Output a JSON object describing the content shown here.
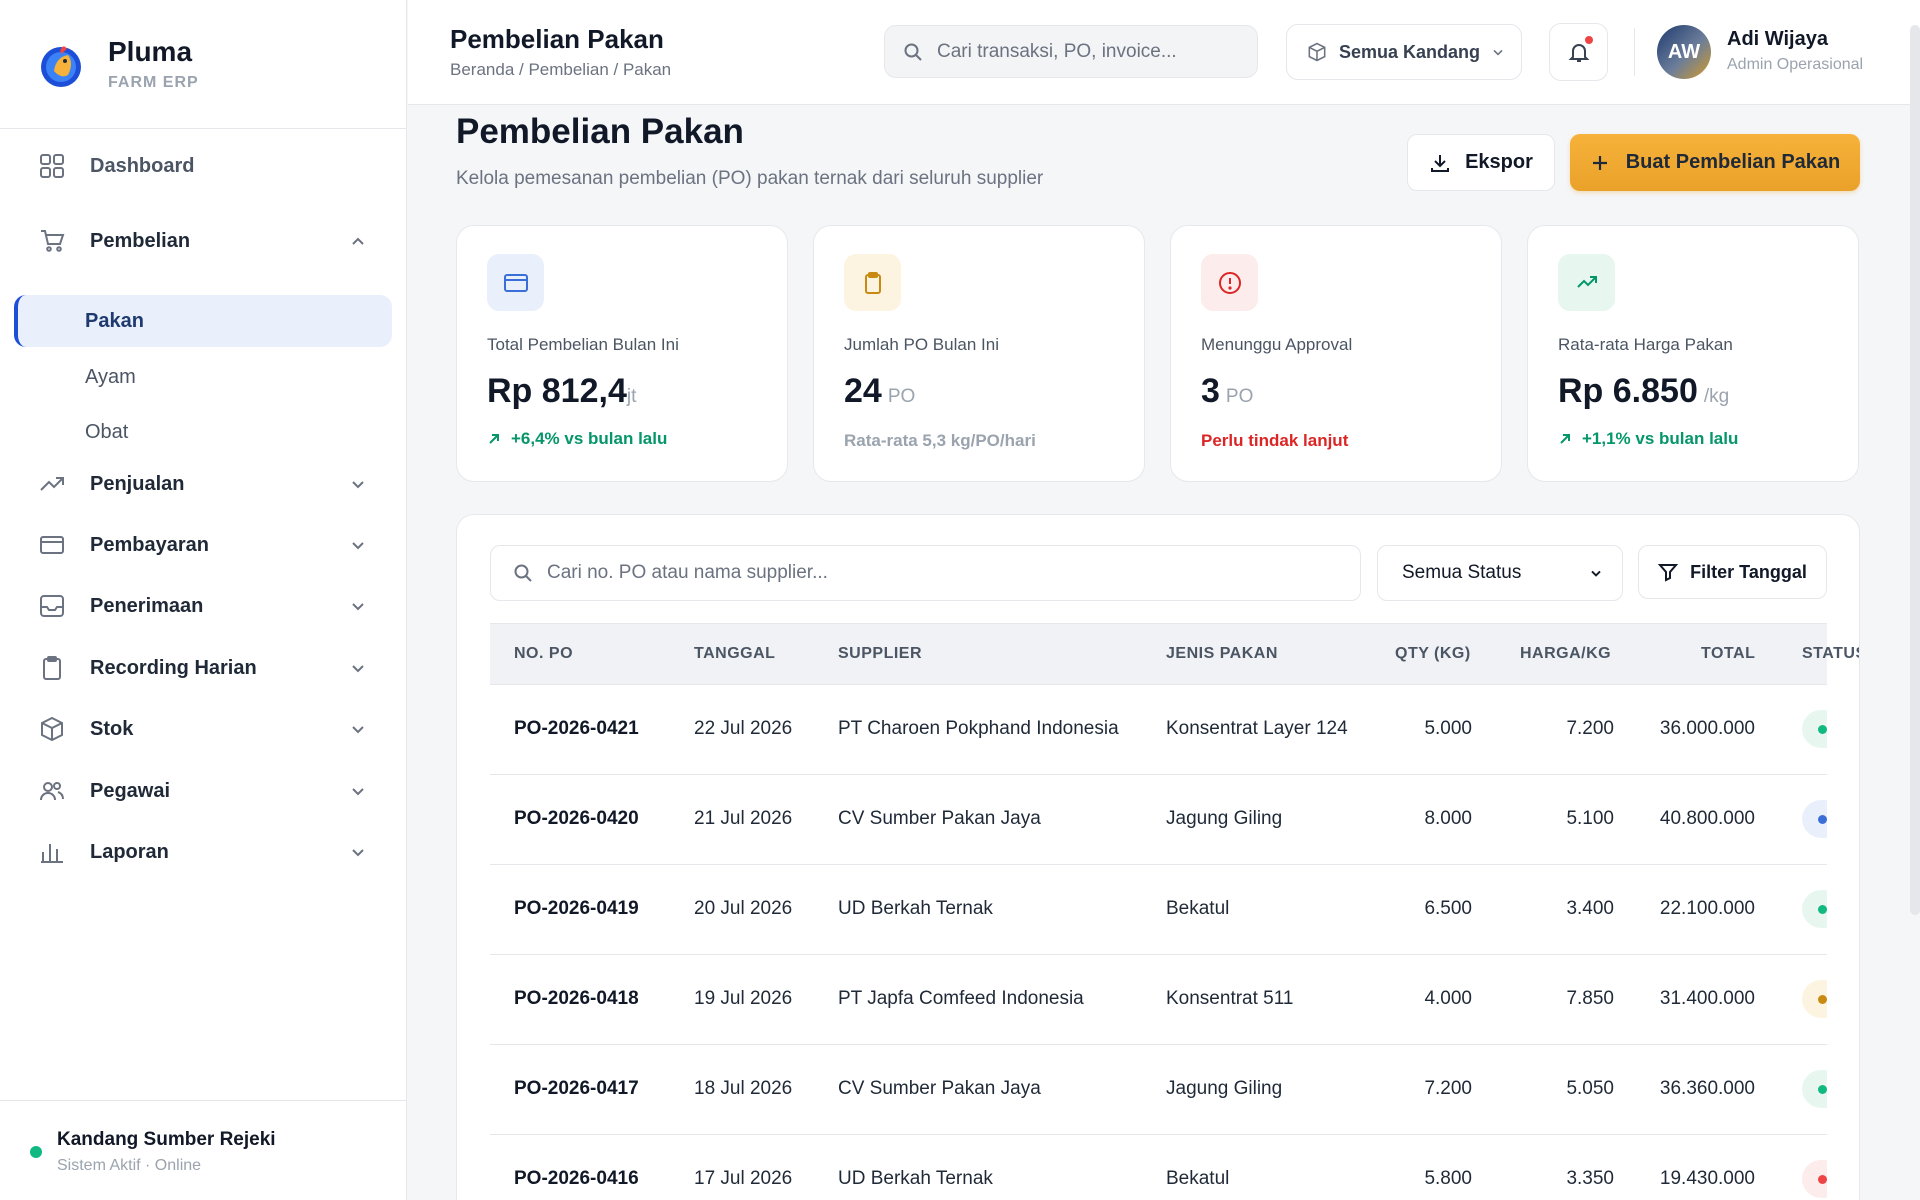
{
  "brand": {
    "name": "Pluma",
    "sub": "FARM ERP"
  },
  "sidebar": {
    "dashboard": "Dashboard",
    "pembelian": "Pembelian",
    "sub": [
      "Pakan",
      "Ayam",
      "Obat"
    ],
    "items": [
      "Penjualan",
      "Pembayaran",
      "Penerimaan",
      "Recording Harian",
      "Stok",
      "Pegawai",
      "Laporan"
    ],
    "footer": {
      "title": "Kandang Sumber Rejeki",
      "sub": "Sistem Aktif · Online"
    }
  },
  "topbar": {
    "title": "Pembelian Pakan",
    "breadcrumb": "Beranda / Pembelian / Pakan",
    "search_placeholder": "Cari transaksi, PO, invoice...",
    "kandang_select": "Semua Kandang",
    "user": {
      "initials": "AW",
      "name": "Adi Wijaya",
      "role": "Admin Operasional"
    }
  },
  "page": {
    "heading": "Pembelian Pakan",
    "subtitle": "Kelola pemesanan pembelian (PO) pakan ternak dari seluruh supplier",
    "export_label": "Ekspor",
    "create_label": "Buat Pembelian Pakan"
  },
  "stats": [
    {
      "label": "Total Pembelian Bulan Ini",
      "value": "Rp 812,4",
      "unit": "jt",
      "foot": "+6,4% vs bulan lalu",
      "icon": "credit-card-icon"
    },
    {
      "label": "Jumlah PO Bulan Ini",
      "value": "24",
      "unit": "PO",
      "foot": "Rata-rata 5,3 kg/PO/hari",
      "icon": "clipboard-icon"
    },
    {
      "label": "Menunggu Approval",
      "value": "3",
      "unit": "PO",
      "foot": "Perlu tindak lanjut",
      "icon": "alert-circle-icon"
    },
    {
      "label": "Rata-rata Harga Pakan",
      "value": "Rp 6.850",
      "unit": "/kg",
      "foot": "+1,1% vs bulan lalu",
      "icon": "trending-up-icon"
    }
  ],
  "table": {
    "search_placeholder": "Cari no. PO atau nama supplier...",
    "status_select": "Semua Status",
    "filter_label": "Filter Tanggal",
    "headers": [
      "NO. PO",
      "TANGGAL",
      "SUPPLIER",
      "JENIS PAKAN",
      "QTY (KG)",
      "HARGA/KG",
      "TOTAL",
      "STATUS"
    ],
    "rows": [
      {
        "po": "PO-2026-0421",
        "date": "22 Jul 2026",
        "supplier": "PT Charoen Pokphand Indonesia",
        "feed": "Konsentrat Layer 124",
        "qty": "5.000",
        "price": "7.200",
        "total": "36.000.000",
        "status_color": "#10b981",
        "status_bg": "#e7f7f0"
      },
      {
        "po": "PO-2026-0420",
        "date": "21 Jul 2026",
        "supplier": "CV Sumber Pakan Jaya",
        "feed": "Jagung Giling",
        "qty": "8.000",
        "price": "5.100",
        "total": "40.800.000",
        "status_color": "#3b6fd8",
        "status_bg": "#eaf0fb"
      },
      {
        "po": "PO-2026-0419",
        "date": "20 Jul 2026",
        "supplier": "UD Berkah Ternak",
        "feed": "Bekatul",
        "qty": "6.500",
        "price": "3.400",
        "total": "22.100.000",
        "status_color": "#10b981",
        "status_bg": "#e7f7f0"
      },
      {
        "po": "PO-2026-0418",
        "date": "19 Jul 2026",
        "supplier": "PT Japfa Comfeed Indonesia",
        "feed": "Konsentrat 511",
        "qty": "4.000",
        "price": "7.850",
        "total": "31.400.000",
        "status_color": "#c98a12",
        "status_bg": "#fdf3e1"
      },
      {
        "po": "PO-2026-0417",
        "date": "18 Jul 2026",
        "supplier": "CV Sumber Pakan Jaya",
        "feed": "Jagung Giling",
        "qty": "7.200",
        "price": "5.050",
        "total": "36.360.000",
        "status_color": "#10b981",
        "status_bg": "#e7f7f0"
      },
      {
        "po": "PO-2026-0416",
        "date": "17 Jul 2026",
        "supplier": "UD Berkah Ternak",
        "feed": "Bekatul",
        "qty": "5.800",
        "price": "3.350",
        "total": "19.430.000",
        "status_color": "#ef4444",
        "status_bg": "#fdecec"
      }
    ]
  }
}
